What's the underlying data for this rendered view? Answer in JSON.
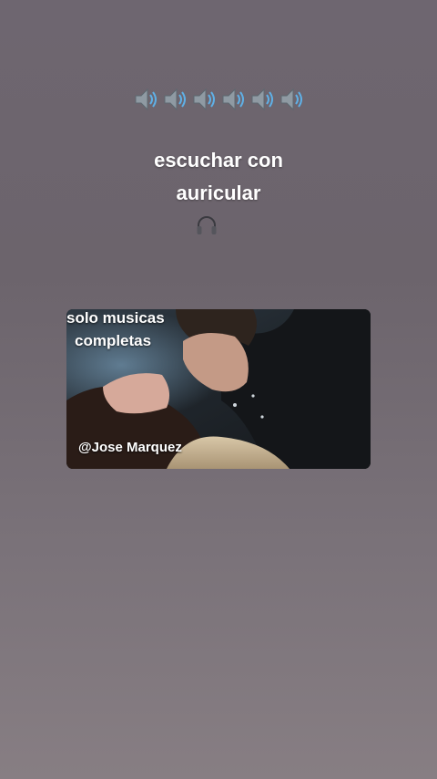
{
  "speakers": {
    "icon": "speaker-high-volume-icon",
    "count": 6
  },
  "caption": {
    "line1": "escuchar con",
    "line2": "auricular",
    "icon": "headphone-icon"
  },
  "video": {
    "text_line1": "solo musicas",
    "text_line2": "completas",
    "handle": "@Jose Marquez"
  },
  "colors": {
    "background_top": "#6e6670",
    "background_bottom": "#877e83",
    "text": "#ffffff"
  }
}
